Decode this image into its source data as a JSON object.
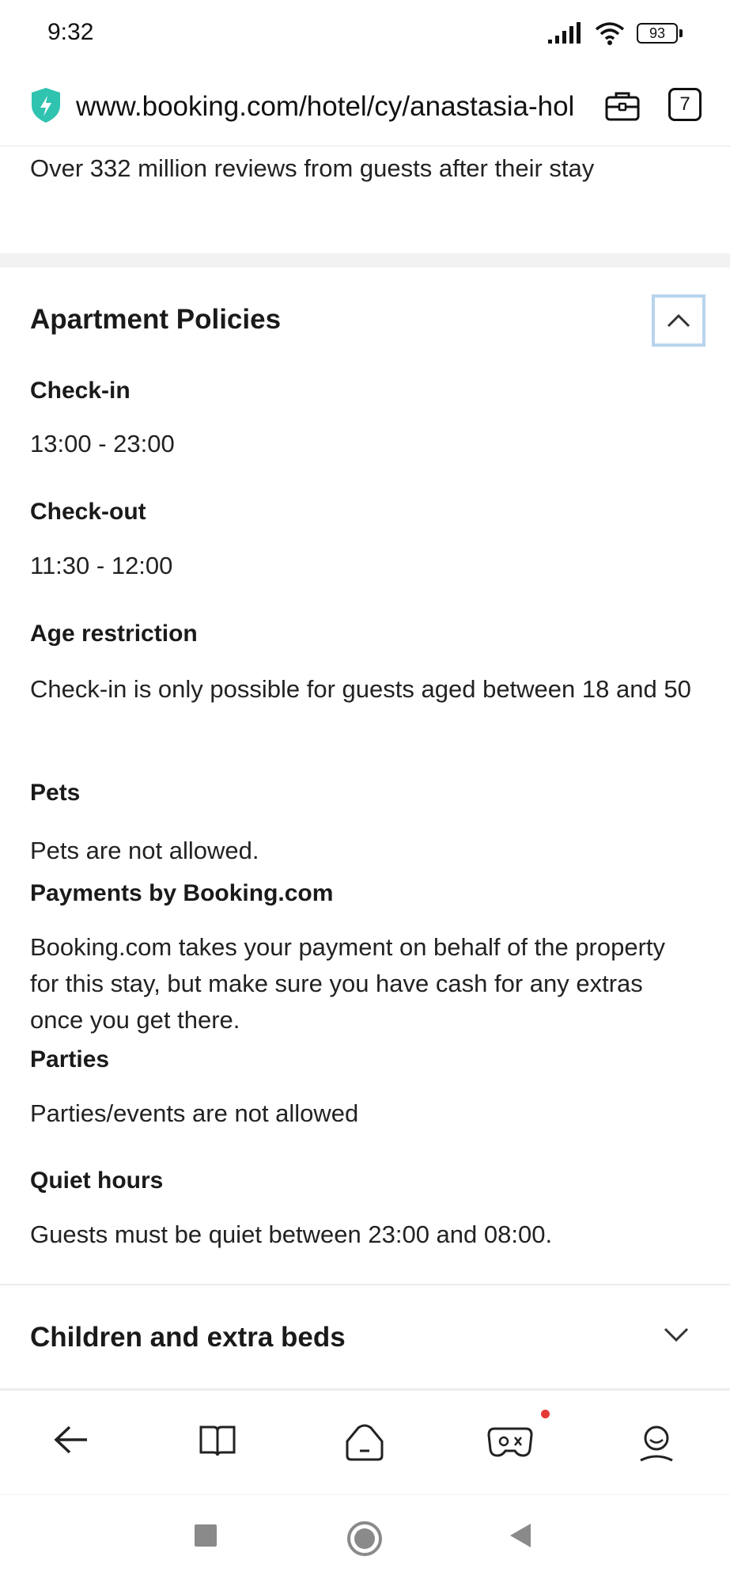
{
  "status_bar": {
    "time": "9:32",
    "battery": "93"
  },
  "browser": {
    "url": "www.booking.com/hotel/cy/anastasia-hol",
    "tab_count": "7",
    "secure_icon": "shield-bolt-icon",
    "accent_color": "#2fc3b0"
  },
  "reviews_text": "Over 332 million reviews from guests after their stay",
  "policies": {
    "title": "Apartment Policies",
    "items": [
      {
        "label": "Check-in",
        "value": "13:00 - 23:00"
      },
      {
        "label": "Check-out",
        "value": "11:30 - 12:00"
      },
      {
        "label": "Age restriction",
        "value": "Check-in is only possible for guests aged between 18 and 50"
      },
      {
        "label": "Pets",
        "value": "Pets are not allowed."
      },
      {
        "label": "Payments by Booking.com",
        "value": "Booking.com takes your payment on behalf of the property for this stay, but make sure you have cash for any extras once you get there."
      },
      {
        "label": "Parties",
        "value": "Parties/events are not allowed"
      },
      {
        "label": "Quiet hours",
        "value": "Guests must be quiet between 23:00 and 08:00."
      }
    ]
  },
  "children_section": {
    "title": "Children and extra beds"
  },
  "bottom_nav": {
    "icons": [
      "back-arrow-icon",
      "book-icon",
      "home-icon",
      "gamepad-icon",
      "profile-icon"
    ],
    "notification_color": "#e53935"
  },
  "system_nav": {
    "icons": [
      "recents-square-icon",
      "home-circle-icon",
      "back-triangle-icon"
    ]
  }
}
